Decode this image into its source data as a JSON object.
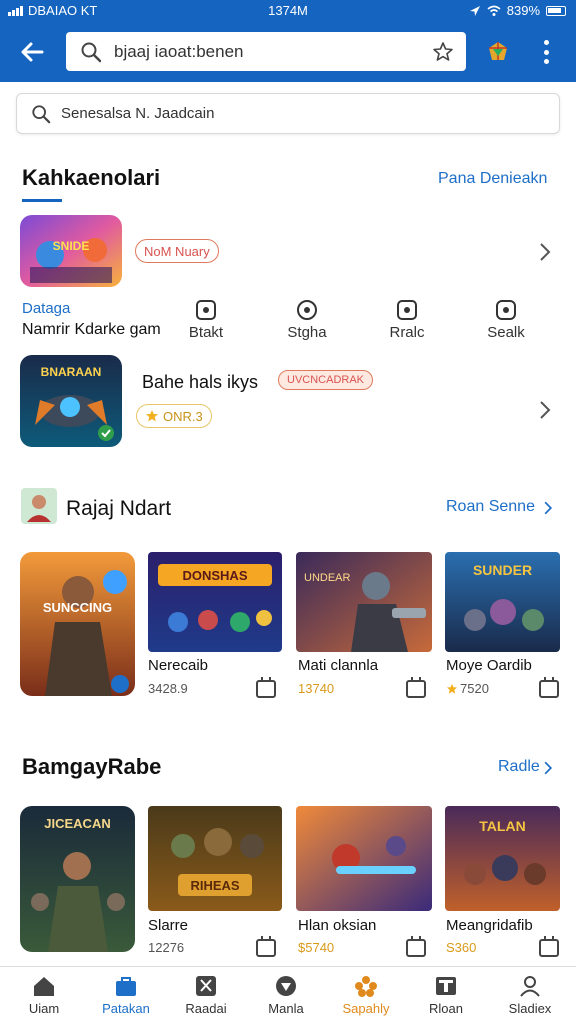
{
  "status_bar": {
    "left_text": "DBAIAO KT",
    "time": "1374M",
    "battery": "839%"
  },
  "search": {
    "query": "bjaaj iaoat:benen"
  },
  "sub_search": {
    "placeholder": "Senesalsa N. Jaadcain"
  },
  "section1": {
    "title": "Kahkaenolari",
    "link": "Pana Denieakn",
    "items": [
      {
        "badge": "NoM Nuary",
        "tile_text": "SNIDE"
      },
      {
        "name": "Bahe hals ikys",
        "badge": "UVCNCADRAK",
        "rating": "ONR.3",
        "tile_text": "BNARAAN"
      }
    ],
    "quick_title": "Dataga",
    "quick_sub": "Namrir Kdarke gam",
    "quick_links": [
      "Btakt",
      "Stgha",
      "Rralc",
      "Sealk"
    ]
  },
  "section2": {
    "title": "Rajaj Ndart",
    "link": "Roan Senne",
    "cards": [
      {
        "name": "",
        "price": "",
        "art": "SUNCCING"
      },
      {
        "name": "Nerecaib",
        "price": "3428.9",
        "art": "DONSHAS"
      },
      {
        "name": "Mati clannla",
        "price": "13740",
        "art": "UNDEAR"
      },
      {
        "name": "Moye Oardib",
        "price": "7520",
        "art": "SUNDER"
      }
    ]
  },
  "section3": {
    "title": "BamgayRabe",
    "link": "Radle",
    "cards": [
      {
        "name": "",
        "price": "",
        "art": "JICEACAN"
      },
      {
        "name": "Slarre",
        "price": "12276",
        "art": "RIHEAS"
      },
      {
        "name": "Hlan oksian",
        "price": "$5740",
        "art": ""
      },
      {
        "name": "Meangridafib",
        "price": "S360",
        "art": "TALAN"
      }
    ]
  },
  "bottom_nav": [
    {
      "label": "Uiam",
      "icon": "home-icon"
    },
    {
      "label": "Patakan",
      "icon": "store-icon"
    },
    {
      "label": "Raadai",
      "icon": "scissors-icon"
    },
    {
      "label": "Manla",
      "icon": "shield-icon"
    },
    {
      "label": "Sapahly",
      "icon": "flower-icon"
    },
    {
      "label": "Rloan",
      "icon": "card-icon"
    },
    {
      "label": "Sladiex",
      "icon": "person-icon"
    }
  ],
  "colors": {
    "appbar": "#1565c0",
    "link": "#1e6fc7",
    "active_orange": "#e08a1e"
  }
}
